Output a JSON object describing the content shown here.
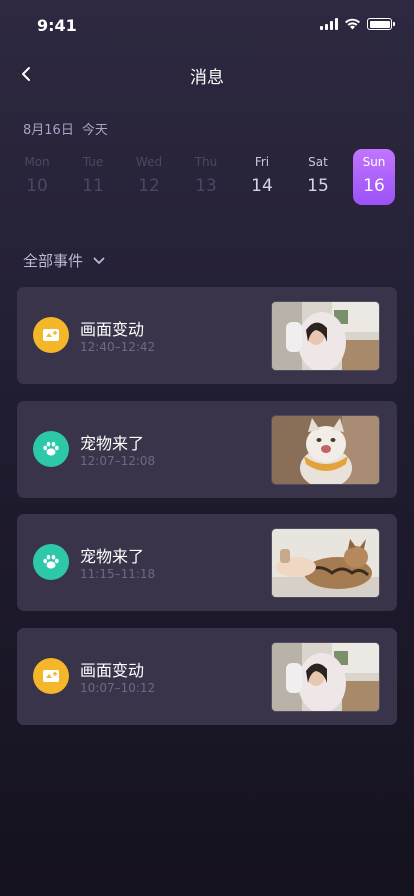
{
  "status_bar": {
    "time": "9:41"
  },
  "nav": {
    "title": "消息"
  },
  "date_label": {
    "date": "8月16日",
    "day": "今天"
  },
  "week": [
    {
      "name": "Mon",
      "num": "10",
      "state": "past"
    },
    {
      "name": "Tue",
      "num": "11",
      "state": "past"
    },
    {
      "name": "Wed",
      "num": "12",
      "state": "past"
    },
    {
      "name": "Thu",
      "num": "13",
      "state": "past"
    },
    {
      "name": "Fri",
      "num": "14",
      "state": "near"
    },
    {
      "name": "Sat",
      "num": "15",
      "state": "near"
    },
    {
      "name": "Sun",
      "num": "16",
      "state": "selected"
    }
  ],
  "filter": {
    "label": "全部事件"
  },
  "events": [
    {
      "title": "画面变动",
      "time": "12:40–12:42",
      "icon": "image-change-icon",
      "color": "#f5b72a",
      "thumb": "person-room"
    },
    {
      "title": "宠物来了",
      "time": "12:07–12:08",
      "icon": "paw-icon",
      "color": "#2dc8a8",
      "thumb": "cat-scarf"
    },
    {
      "title": "宠物来了",
      "time": "11:15–11:18",
      "icon": "paw-icon",
      "color": "#2dc8a8",
      "thumb": "cat-hand"
    },
    {
      "title": "画面变动",
      "time": "10:07–10:12",
      "icon": "image-change-icon",
      "color": "#f5b72a",
      "thumb": "person-room"
    }
  ],
  "colors": {
    "accent": "#a45cf8",
    "card_bg": "#393449"
  }
}
